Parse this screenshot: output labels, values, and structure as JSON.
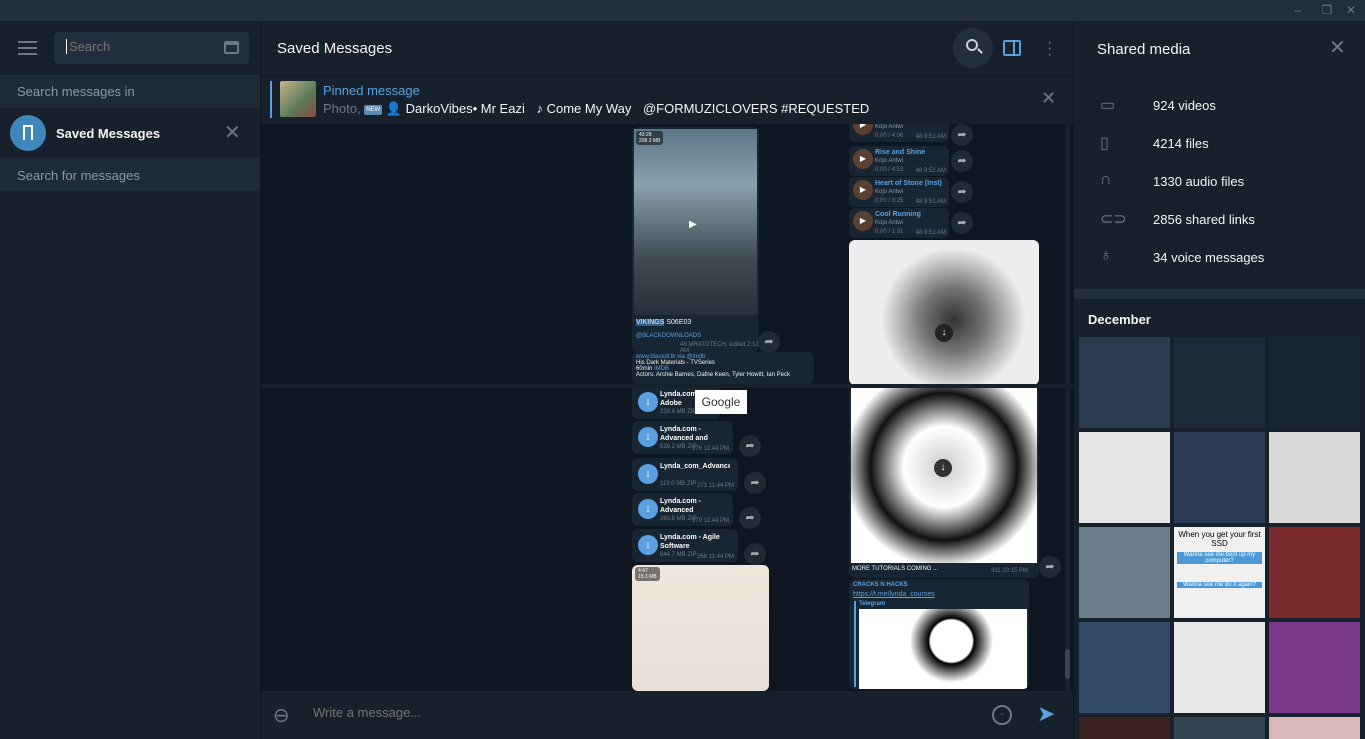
{
  "window": {
    "minimize": "–",
    "maximize": "❐",
    "close": "✕"
  },
  "left": {
    "search_placeholder": "Search",
    "search_in_label": "Search messages in",
    "chat_name": "Saved Messages",
    "search_for_label": "Search for messages"
  },
  "chat": {
    "title": "Saved Messages",
    "pinned": {
      "label": "Pinned message",
      "prefix": "Photo,",
      "new_badge": "NEW",
      "text": "DarkoVibes• Mr Eazi",
      "song": "Come My Way",
      "tags": "@FORMUZICLOVERS #REQUESTED"
    },
    "composer_placeholder": "Write a message...",
    "tooltip": "Google",
    "messages": {
      "vikings": {
        "duration": "43:28",
        "size": "208.3 MB",
        "caption": "VIKINGS",
        "episode": "S06E03",
        "link": "@BLACKDOWNLOADS",
        "meta": "48  MRATOTECH, edited 2:12 AM"
      },
      "imdb": {
        "source": "www.blackdl.tk",
        "via": "via @imdb",
        "title": "His Dark Materials - TVSeries",
        "runtime": "60min",
        "imdb": "IMDB",
        "actors": "Actors: Archie Barnes, Dafne Keen, Tyler Howitt, Ian Peck"
      },
      "files": [
        {
          "name": "Lynda.com - Adobe Photoshop to ...",
          "meta": "228.4 MB ZIP"
        },
        {
          "name": "Lynda.com - Advanced and Specialized...",
          "meta": "539.2 MB ZIP",
          "views": "276  11:44 PM"
        },
        {
          "name": "Lynda_com_Advanced_Animations_and.zip",
          "meta": "119.0 MB ZIP",
          "views": "273  11:44 PM"
        },
        {
          "name": "Lynda.com - Advanced Appium.zip",
          "meta": "260.8 MB ZIP",
          "views": "270  11:44 PM"
        },
        {
          "name": "Lynda.com - Agile Software Developmen...",
          "meta": "644.7 MB ZIP",
          "views": "268  11:44 PM"
        }
      ],
      "video2": {
        "duration": "4:47",
        "size": "15.1 MB"
      },
      "audios": [
        {
          "title": "",
          "artist": "Kojo Antwi",
          "time": "0:00 / 4:06",
          "meta": "48  9:51 AM"
        },
        {
          "title": "Rise and Shine",
          "artist": "Kojo Antwi",
          "time": "0:00 / 4:53",
          "meta": "48  9:51 AM"
        },
        {
          "title": "Heart of Stone (Inst)",
          "artist": "Kojo Antwi",
          "time": "0:00 / 3:25",
          "meta": "48  9:51 AM"
        },
        {
          "title": "Cool Running",
          "artist": "Kojo Antwi",
          "time": "0:00 / 1:31",
          "meta": "48  9:51 AM"
        }
      ],
      "photo_caption": "MORE TUTORIALS COMING ...",
      "photo_meta": "311  10:15 PM",
      "cracks": {
        "title": "CRACKS N HACKS",
        "link": "https://t.me/lynda_courses",
        "site": "Telegram"
      }
    }
  },
  "right": {
    "title": "Shared media",
    "items": [
      {
        "icon": "video-icon",
        "label": "924 videos"
      },
      {
        "icon": "file-icon",
        "label": "4214 files"
      },
      {
        "icon": "headphones-icon",
        "label": "1330 audio files"
      },
      {
        "icon": "link-icon",
        "label": "2856 shared links"
      },
      {
        "icon": "microphone-icon",
        "label": "34 voice messages"
      }
    ],
    "month": "December",
    "tiles": [
      "#2b3a4c",
      "#1e2a38",
      "#1b2633",
      "#e6e6e6",
      "#2a3c55",
      "#d9d9d9",
      "#6a7b8a",
      "#f0f0f0",
      "#7b2b2b",
      "#334a66",
      "#e8e8e8",
      "#7a3a8a",
      "#3a2020",
      "#334455",
      "#d8b8b8"
    ],
    "meme_text": "When you get your first SSD",
    "meme_text2": "Wanna see me boot up my computer?",
    "meme_text3": "Wanna see me do it again?"
  },
  "colors": {
    "accent": "#5ba1e2",
    "bg": "#17212b",
    "chat_bg": "#0e1621"
  }
}
